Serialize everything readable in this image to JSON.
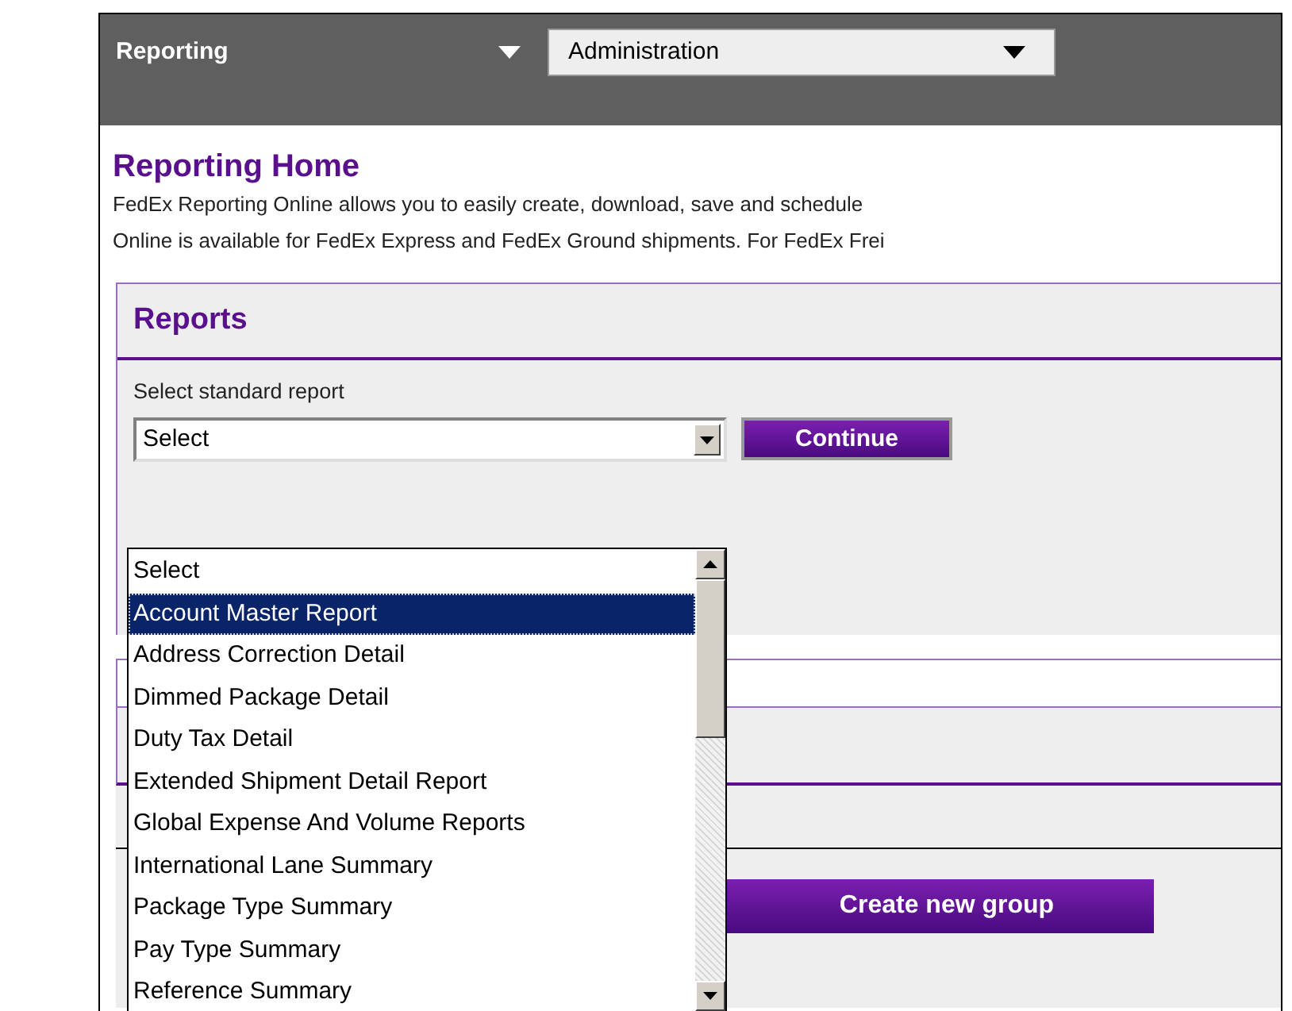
{
  "tabs": [
    {
      "label": "Reporting",
      "selected": true
    },
    {
      "label": "Administration",
      "selected": false
    }
  ],
  "page_title": "Reporting Home",
  "description": [
    "FedEx Reporting Online allows you to easily create, download, save and schedule",
    "Online is available for FedEx Express and FedEx Ground shipments. For FedEx Frei"
  ],
  "reports_panel": {
    "title": "Reports",
    "label": "Select standard report",
    "select_value": "Select",
    "continue_button": "Continue",
    "options": [
      {
        "label": "Select",
        "selected": false
      },
      {
        "label": "Account Master Report",
        "selected": true
      },
      {
        "label": "Address Correction Detail",
        "selected": false
      },
      {
        "label": "Dimmed Package Detail",
        "selected": false
      },
      {
        "label": "Duty Tax Detail",
        "selected": false
      },
      {
        "label": "Extended Shipment Detail Report",
        "selected": false
      },
      {
        "label": "Global Expense And Volume Reports",
        "selected": false
      },
      {
        "label": "International Lane Summary",
        "selected": false
      },
      {
        "label": "Package Type Summary",
        "selected": false
      },
      {
        "label": "Pay Type Summary",
        "selected": false
      },
      {
        "label": "Reference Summary",
        "selected": false
      }
    ]
  },
  "group_button": "Create new group"
}
